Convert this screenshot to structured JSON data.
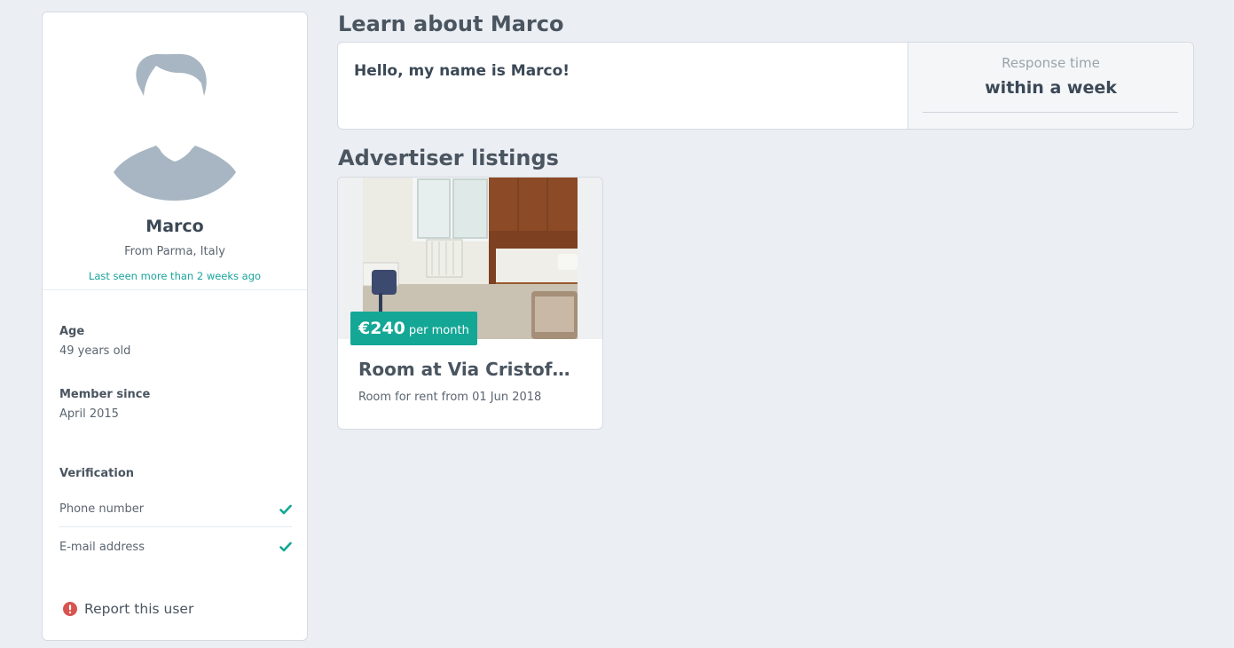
{
  "profile": {
    "name": "Marco",
    "from": "From Parma, Italy",
    "last_seen": "Last seen more than 2 weeks ago",
    "age_label": "Age",
    "age_value": "49 years old",
    "member_label": "Member since",
    "member_value": "April 2015",
    "verification_label": "Verification",
    "verifications": [
      {
        "label": "Phone number",
        "verified": true
      },
      {
        "label": "E-mail address",
        "verified": true
      }
    ],
    "report_label": "Report this user"
  },
  "about": {
    "title": "Learn about Marco",
    "text": "Hello, my name is Marco!",
    "response_label": "Response time",
    "response_value": "within a week"
  },
  "listings": {
    "title": "Advertiser listings",
    "items": [
      {
        "price": "€240",
        "period": "per month",
        "title": "Room at Via Cristof…",
        "subtitle": "Room for rent from 01 Jun 2018"
      }
    ]
  },
  "colors": {
    "accent": "#14a796",
    "alert": "#d9534f",
    "background": "#ebeef3",
    "avatar": "#a7b6c2"
  }
}
